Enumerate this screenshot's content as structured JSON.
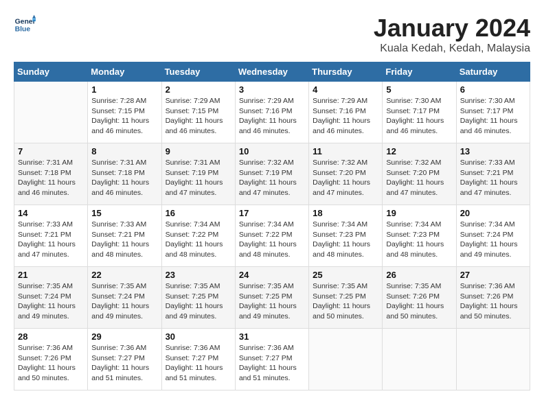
{
  "header": {
    "logo_line1": "General",
    "logo_line2": "Blue",
    "month_title": "January 2024",
    "location": "Kuala Kedah, Kedah, Malaysia"
  },
  "days_of_week": [
    "Sunday",
    "Monday",
    "Tuesday",
    "Wednesday",
    "Thursday",
    "Friday",
    "Saturday"
  ],
  "weeks": [
    [
      {
        "day": "",
        "info": ""
      },
      {
        "day": "1",
        "info": "Sunrise: 7:28 AM\nSunset: 7:15 PM\nDaylight: 11 hours\nand 46 minutes."
      },
      {
        "day": "2",
        "info": "Sunrise: 7:29 AM\nSunset: 7:15 PM\nDaylight: 11 hours\nand 46 minutes."
      },
      {
        "day": "3",
        "info": "Sunrise: 7:29 AM\nSunset: 7:16 PM\nDaylight: 11 hours\nand 46 minutes."
      },
      {
        "day": "4",
        "info": "Sunrise: 7:29 AM\nSunset: 7:16 PM\nDaylight: 11 hours\nand 46 minutes."
      },
      {
        "day": "5",
        "info": "Sunrise: 7:30 AM\nSunset: 7:17 PM\nDaylight: 11 hours\nand 46 minutes."
      },
      {
        "day": "6",
        "info": "Sunrise: 7:30 AM\nSunset: 7:17 PM\nDaylight: 11 hours\nand 46 minutes."
      }
    ],
    [
      {
        "day": "7",
        "info": "Sunrise: 7:31 AM\nSunset: 7:18 PM\nDaylight: 11 hours\nand 46 minutes."
      },
      {
        "day": "8",
        "info": "Sunrise: 7:31 AM\nSunset: 7:18 PM\nDaylight: 11 hours\nand 46 minutes."
      },
      {
        "day": "9",
        "info": "Sunrise: 7:31 AM\nSunset: 7:19 PM\nDaylight: 11 hours\nand 47 minutes."
      },
      {
        "day": "10",
        "info": "Sunrise: 7:32 AM\nSunset: 7:19 PM\nDaylight: 11 hours\nand 47 minutes."
      },
      {
        "day": "11",
        "info": "Sunrise: 7:32 AM\nSunset: 7:20 PM\nDaylight: 11 hours\nand 47 minutes."
      },
      {
        "day": "12",
        "info": "Sunrise: 7:32 AM\nSunset: 7:20 PM\nDaylight: 11 hours\nand 47 minutes."
      },
      {
        "day": "13",
        "info": "Sunrise: 7:33 AM\nSunset: 7:21 PM\nDaylight: 11 hours\nand 47 minutes."
      }
    ],
    [
      {
        "day": "14",
        "info": "Sunrise: 7:33 AM\nSunset: 7:21 PM\nDaylight: 11 hours\nand 47 minutes."
      },
      {
        "day": "15",
        "info": "Sunrise: 7:33 AM\nSunset: 7:21 PM\nDaylight: 11 hours\nand 48 minutes."
      },
      {
        "day": "16",
        "info": "Sunrise: 7:34 AM\nSunset: 7:22 PM\nDaylight: 11 hours\nand 48 minutes."
      },
      {
        "day": "17",
        "info": "Sunrise: 7:34 AM\nSunset: 7:22 PM\nDaylight: 11 hours\nand 48 minutes."
      },
      {
        "day": "18",
        "info": "Sunrise: 7:34 AM\nSunset: 7:23 PM\nDaylight: 11 hours\nand 48 minutes."
      },
      {
        "day": "19",
        "info": "Sunrise: 7:34 AM\nSunset: 7:23 PM\nDaylight: 11 hours\nand 48 minutes."
      },
      {
        "day": "20",
        "info": "Sunrise: 7:34 AM\nSunset: 7:24 PM\nDaylight: 11 hours\nand 49 minutes."
      }
    ],
    [
      {
        "day": "21",
        "info": "Sunrise: 7:35 AM\nSunset: 7:24 PM\nDaylight: 11 hours\nand 49 minutes."
      },
      {
        "day": "22",
        "info": "Sunrise: 7:35 AM\nSunset: 7:24 PM\nDaylight: 11 hours\nand 49 minutes."
      },
      {
        "day": "23",
        "info": "Sunrise: 7:35 AM\nSunset: 7:25 PM\nDaylight: 11 hours\nand 49 minutes."
      },
      {
        "day": "24",
        "info": "Sunrise: 7:35 AM\nSunset: 7:25 PM\nDaylight: 11 hours\nand 49 minutes."
      },
      {
        "day": "25",
        "info": "Sunrise: 7:35 AM\nSunset: 7:25 PM\nDaylight: 11 hours\nand 50 minutes."
      },
      {
        "day": "26",
        "info": "Sunrise: 7:35 AM\nSunset: 7:26 PM\nDaylight: 11 hours\nand 50 minutes."
      },
      {
        "day": "27",
        "info": "Sunrise: 7:36 AM\nSunset: 7:26 PM\nDaylight: 11 hours\nand 50 minutes."
      }
    ],
    [
      {
        "day": "28",
        "info": "Sunrise: 7:36 AM\nSunset: 7:26 PM\nDaylight: 11 hours\nand 50 minutes."
      },
      {
        "day": "29",
        "info": "Sunrise: 7:36 AM\nSunset: 7:27 PM\nDaylight: 11 hours\nand 51 minutes."
      },
      {
        "day": "30",
        "info": "Sunrise: 7:36 AM\nSunset: 7:27 PM\nDaylight: 11 hours\nand 51 minutes."
      },
      {
        "day": "31",
        "info": "Sunrise: 7:36 AM\nSunset: 7:27 PM\nDaylight: 11 hours\nand 51 minutes."
      },
      {
        "day": "",
        "info": ""
      },
      {
        "day": "",
        "info": ""
      },
      {
        "day": "",
        "info": ""
      }
    ]
  ]
}
